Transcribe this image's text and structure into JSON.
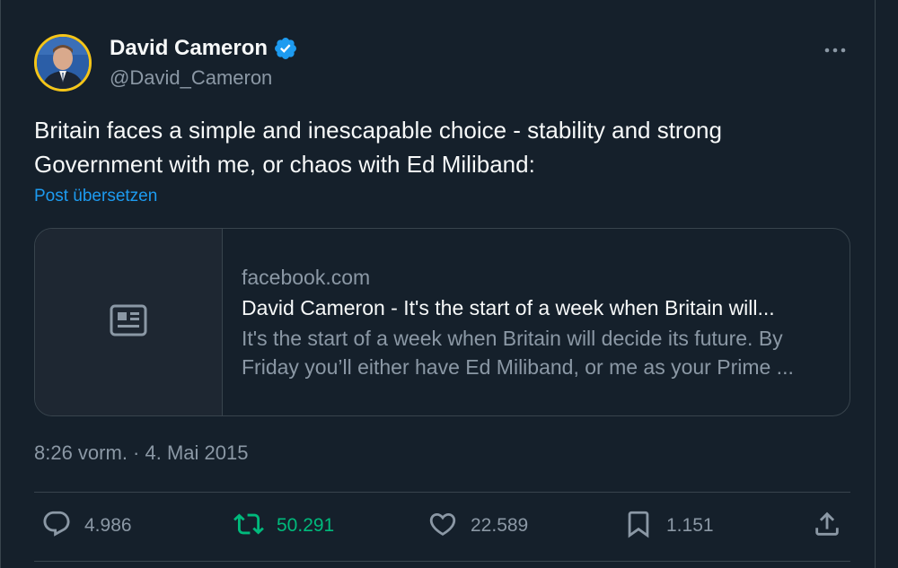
{
  "author": {
    "name": "David Cameron",
    "handle": "@David_Cameron",
    "verified": true
  },
  "tweet": {
    "text_lines": [
      "Britain faces a simple and inescapable choice - stability and strong",
      "Government with me, or chaos with Ed Miliband:"
    ],
    "translate_label": "Post übersetzen",
    "timestamp": "8:26 vorm. · 4. Mai 2015"
  },
  "link_card": {
    "domain": "facebook.com",
    "title": "David Cameron - It's the start of a week when Britain will...",
    "description_lines": [
      "It's the start of a week when Britain will decide its future. By",
      "Friday you’ll either have Ed Miliband, or me as your Prime ..."
    ],
    "thumbnail_icon": "news-article-icon"
  },
  "actions": {
    "replies": "4.986",
    "retweets": "50.291",
    "likes": "22.589",
    "bookmarks": "1.151"
  },
  "colors": {
    "background": "#15202b",
    "text_primary": "#f7f9f9",
    "text_secondary": "#8b98a5",
    "accent_blue": "#1d9bf0",
    "retweet_green": "#00ba7c",
    "border": "#38444d"
  },
  "icons": {
    "more": "more-options-icon",
    "verified": "verified-badge-icon",
    "reply": "reply-icon",
    "retweet": "retweet-icon",
    "like": "heart-icon",
    "bookmark": "bookmark-icon",
    "share": "share-icon"
  }
}
